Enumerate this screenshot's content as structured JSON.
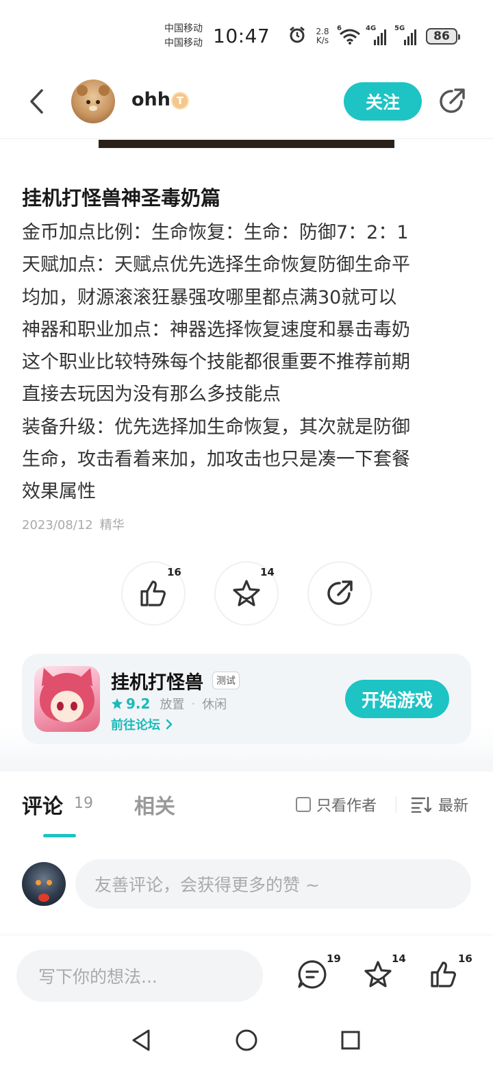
{
  "status_bar": {
    "carrier1": "中国移动",
    "carrier2": "中国移动",
    "time": "10:47",
    "net_speed_value": "2.8",
    "net_speed_unit": "K/s",
    "wifi_tag": "6",
    "sig1_tag": "4G",
    "sig2_tag": "5G",
    "battery": "86"
  },
  "header": {
    "username": "ohh",
    "level_badge": "T",
    "follow_label": "关注"
  },
  "article": {
    "title": "挂机打怪兽神圣毒奶篇",
    "lines": [
      "金币加点比例：生命恢复：生命：防御7：2：1",
      "天赋加点：天赋点优先选择生命恢复防御生命平",
      "均加，财源滚滚狂暴强攻哪里都点满30就可以",
      "神器和职业加点：神器选择恢复速度和暴击毒奶",
      "这个职业比较特殊每个技能都很重要不推荐前期",
      "直接去玩因为没有那么多技能点",
      "装备升级：优先选择加生命恢复，其次就是防御",
      "生命，攻击看着来加，加攻击也只是凑一下套餐",
      "效果属性"
    ],
    "date": "2023/08/12",
    "tag": "精华"
  },
  "actions": {
    "like_count": "16",
    "favorite_count": "14"
  },
  "game_card": {
    "name": "挂机打怪兽",
    "test_tag": "测试",
    "rating": "9.2",
    "genre1": "放置",
    "genre_sep": "·",
    "genre2": "休闲",
    "forum_link": "前往论坛",
    "play_label": "开始游戏"
  },
  "comments": {
    "tab_comments": "评论",
    "tab_comments_count": "19",
    "tab_related": "相关",
    "only_author_label": "只看作者",
    "sort_label": "最新",
    "input_placeholder": "友善评论，会获得更多的赞 ~"
  },
  "bottom_bar": {
    "reply_placeholder": "写下你的想法...",
    "comment_count": "19",
    "favorite_count": "14",
    "like_count": "16"
  },
  "colors": {
    "accent": "#1ec3c4",
    "text_primary": "#222222",
    "text_muted": "#999999",
    "card_bg": "#f2f5f7"
  }
}
